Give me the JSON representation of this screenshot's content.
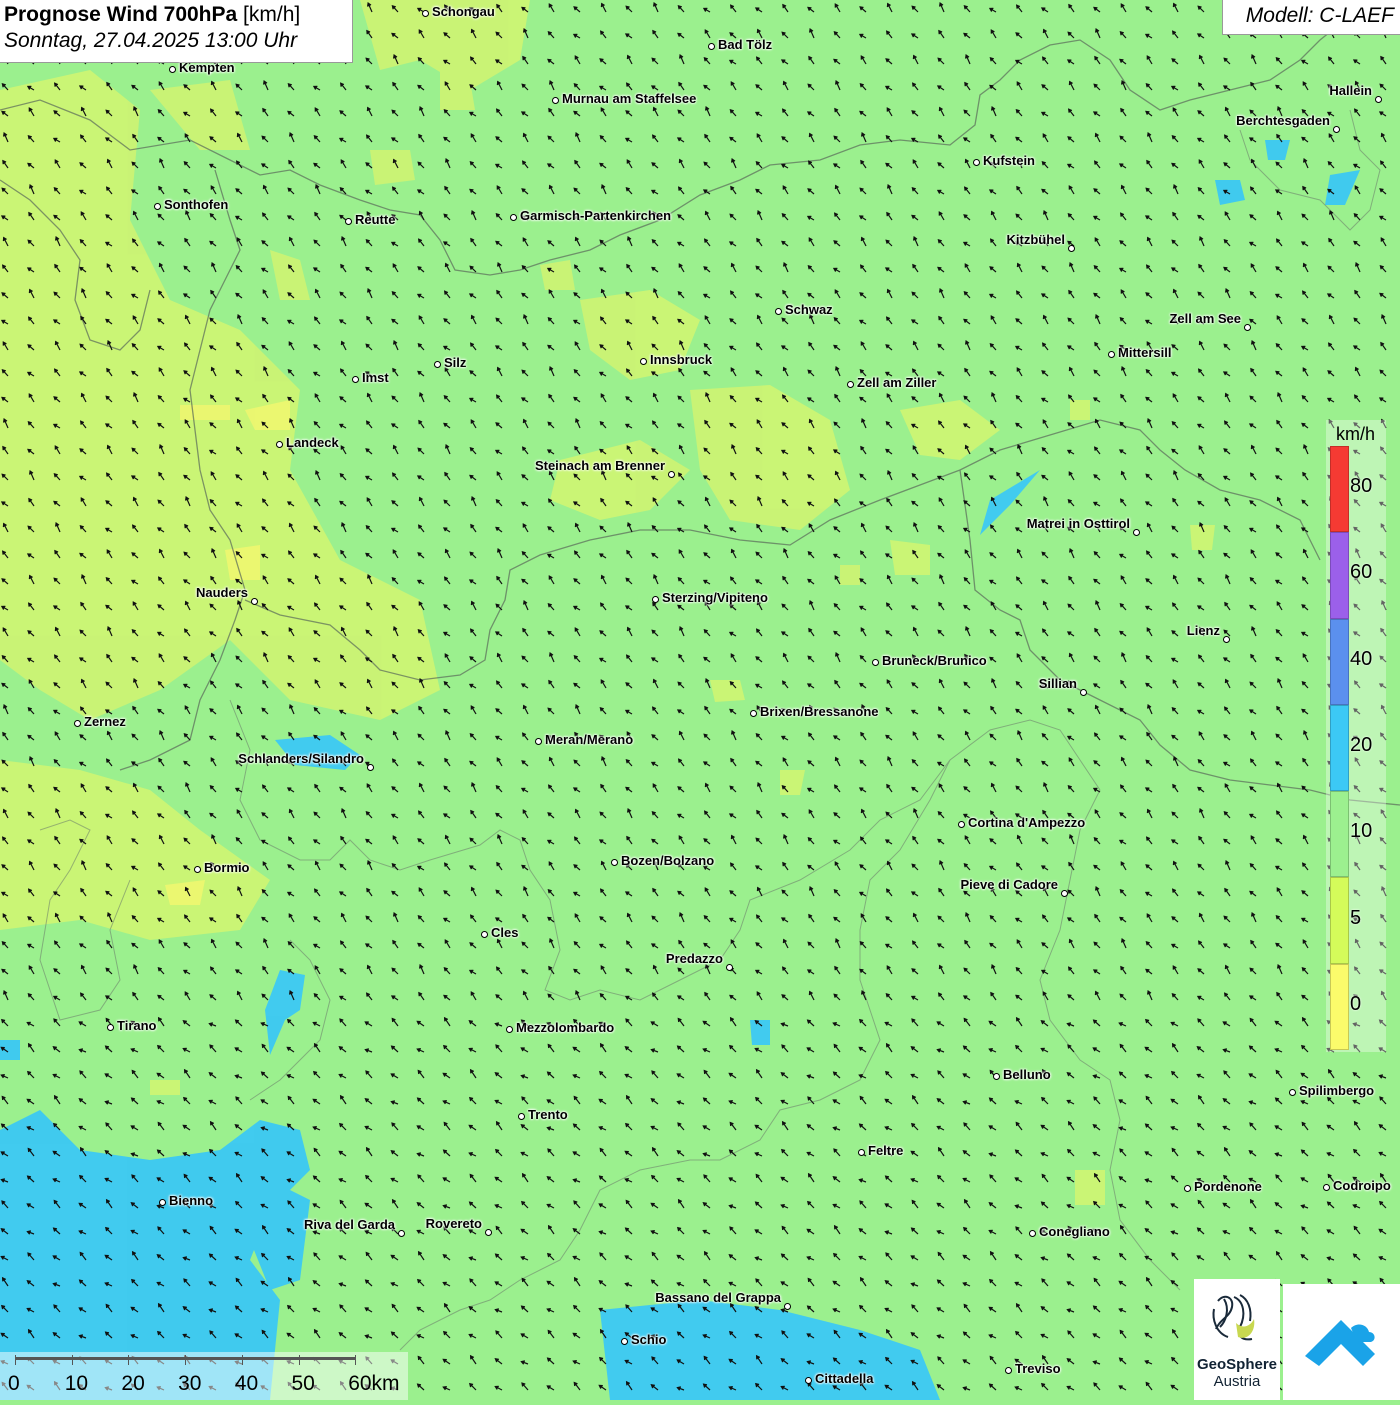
{
  "title": {
    "line1_bold": "Prognose Wind 700hPa",
    "line1_unit": " [km/h]",
    "line2": "Sonntag, 27.04.2025 13:00 Uhr"
  },
  "model": "Modell: C-LAEF",
  "legend": {
    "unit": "km/h",
    "ticks": [
      "80",
      "60",
      "40",
      "20",
      "10",
      "5",
      "0"
    ],
    "classes": [
      {
        "label": "0",
        "color": "#fbfb6b"
      },
      {
        "label": "5",
        "color": "#d4fb5a"
      },
      {
        "label": "10",
        "color": "#9cf08f"
      },
      {
        "label": "20",
        "color": "#3cc9f5"
      },
      {
        "label": "40",
        "color": "#5b90ee"
      },
      {
        "label": "60",
        "color": "#9b60ea"
      },
      {
        "label": "80",
        "color": "#f53a33"
      }
    ]
  },
  "scalebar": {
    "labels": [
      "0",
      "10",
      "20",
      "30",
      "40",
      "50",
      "60km"
    ]
  },
  "logos": {
    "geosphere_line1": "GeoSphere",
    "geosphere_line2": "Austria"
  },
  "cities": [
    {
      "name": "Schongau"
    },
    {
      "name": "Bad Tölz"
    },
    {
      "name": "Kempten"
    },
    {
      "name": "Murnau am Staffelsee"
    },
    {
      "name": "Hallein"
    },
    {
      "name": "Berchtesgaden"
    },
    {
      "name": "Kufstein"
    },
    {
      "name": "Sonthofen"
    },
    {
      "name": "Reutte"
    },
    {
      "name": "Garmisch-Partenkirchen"
    },
    {
      "name": "Kitzbühel"
    },
    {
      "name": "Schwaz"
    },
    {
      "name": "Zell am See"
    },
    {
      "name": "Mittersill"
    },
    {
      "name": "Silz"
    },
    {
      "name": "Innsbruck"
    },
    {
      "name": "Imst"
    },
    {
      "name": "Zell am Ziller"
    },
    {
      "name": "Landeck"
    },
    {
      "name": "Steinach am Brenner"
    },
    {
      "name": "Matrei in Osttirol"
    },
    {
      "name": "Nauders"
    },
    {
      "name": "Sterzing/Vipiteno"
    },
    {
      "name": "Lienz"
    },
    {
      "name": "Bruneck/Brunico"
    },
    {
      "name": "Sillian"
    },
    {
      "name": "Zernez"
    },
    {
      "name": "Brixen/Bressanone"
    },
    {
      "name": "Meran/Merano"
    },
    {
      "name": "Schlanders/Silandro"
    },
    {
      "name": "Cortina d'Ampezzo"
    },
    {
      "name": "Bozen/Bolzano"
    },
    {
      "name": "Bormio"
    },
    {
      "name": "Pieve di Cadore"
    },
    {
      "name": "Cles"
    },
    {
      "name": "Predazzo"
    },
    {
      "name": "Tirano"
    },
    {
      "name": "Mezzolombardo"
    },
    {
      "name": "Belluno"
    },
    {
      "name": "Spilimbergo"
    },
    {
      "name": "Trento"
    },
    {
      "name": "Feltre"
    },
    {
      "name": "Pordenone"
    },
    {
      "name": "Codroipo"
    },
    {
      "name": "Bienno"
    },
    {
      "name": "Riva del Garda"
    },
    {
      "name": "Rovereto"
    },
    {
      "name": "Conegliano"
    },
    {
      "name": "Bassano del Grappa"
    },
    {
      "name": "Schio"
    },
    {
      "name": "Treviso"
    },
    {
      "name": "Cittadella"
    }
  ]
}
